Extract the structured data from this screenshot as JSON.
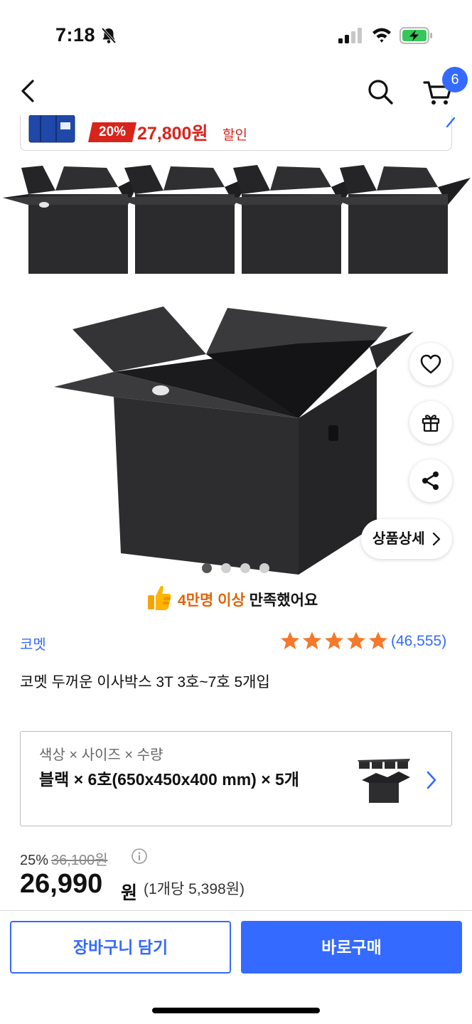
{
  "status_bar": {
    "time": "7:18",
    "icons": [
      "bell-slash-icon",
      "signal-icon",
      "wifi-icon",
      "battery-charging-icon"
    ]
  },
  "nav": {
    "back_icon": "chevron-left-icon",
    "search_icon": "search-icon",
    "cart_icon": "cart-icon",
    "cart_count": "6"
  },
  "promo": {
    "discount": "20%",
    "price": "27,800원",
    "suffix": "할인"
  },
  "gallery": {
    "current_image": 1,
    "image_count": 4,
    "detail_button": "상품상세",
    "side_actions": [
      "heart-icon",
      "gift-icon",
      "share-icon"
    ]
  },
  "satisfaction": {
    "highlight": "4만명 이상",
    "text": " 만족했어요"
  },
  "product": {
    "brand": "코멧",
    "rating": 5,
    "review_count": "(46,555)",
    "title": "코멧 두꺼운 이사박스 3T 3호~7호 5개입"
  },
  "option": {
    "label": "색상 × 사이즈 × 수량",
    "value": "블랙 × 6호(650x450x400 mm) × 5개"
  },
  "price": {
    "discount_rate": "25%",
    "original": "36,100원",
    "sale": "26,990",
    "currency": "원",
    "unit_price": "(1개당 5,398원)"
  },
  "actions": {
    "add_to_cart": "장바구니 담기",
    "buy_now": "바로구매"
  },
  "colors": {
    "accent": "#346aff",
    "sale_red": "#d9241c",
    "orange": "#e0650a",
    "star": "#f5792a"
  }
}
